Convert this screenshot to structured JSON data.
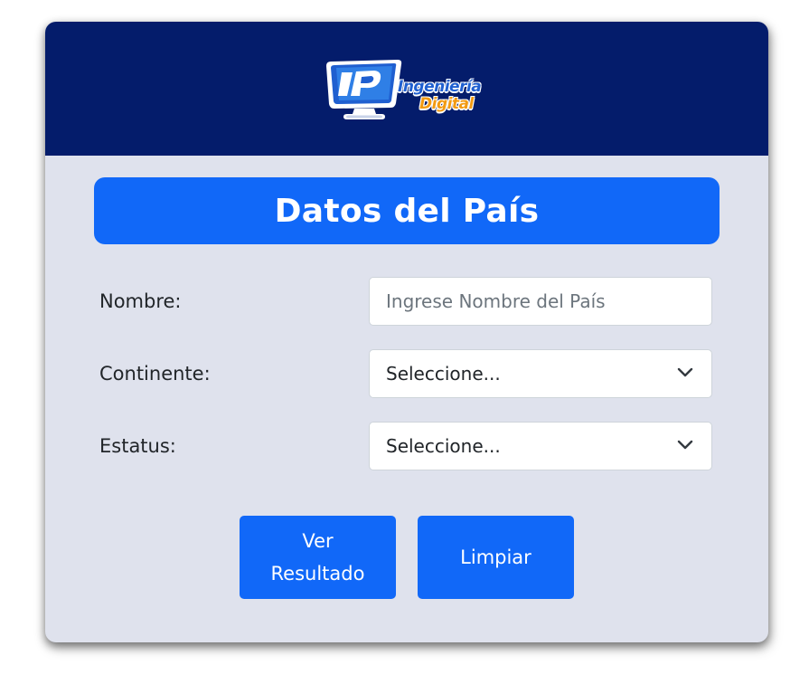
{
  "header": {
    "logo": {
      "icon": "monitor-logo-icon",
      "line1": "Ingeniería",
      "line2": "Digital"
    }
  },
  "form": {
    "title": "Datos del País",
    "fields": {
      "nombre": {
        "label": "Nombre:",
        "value": "",
        "placeholder": "Ingrese Nombre del País"
      },
      "continente": {
        "label": "Continente:",
        "selected": "Seleccione..."
      },
      "estatus": {
        "label": "Estatus:",
        "selected": "Seleccione..."
      }
    },
    "buttons": {
      "ver_resultado": "Ver Resultado",
      "limpiar": "Limpiar"
    }
  },
  "colors": {
    "header_bg": "#041c6b",
    "card_bg": "#dfe2ed",
    "primary": "#1168f8",
    "logo_blue": "#1f5fd0",
    "logo_orange": "#f29a12"
  }
}
